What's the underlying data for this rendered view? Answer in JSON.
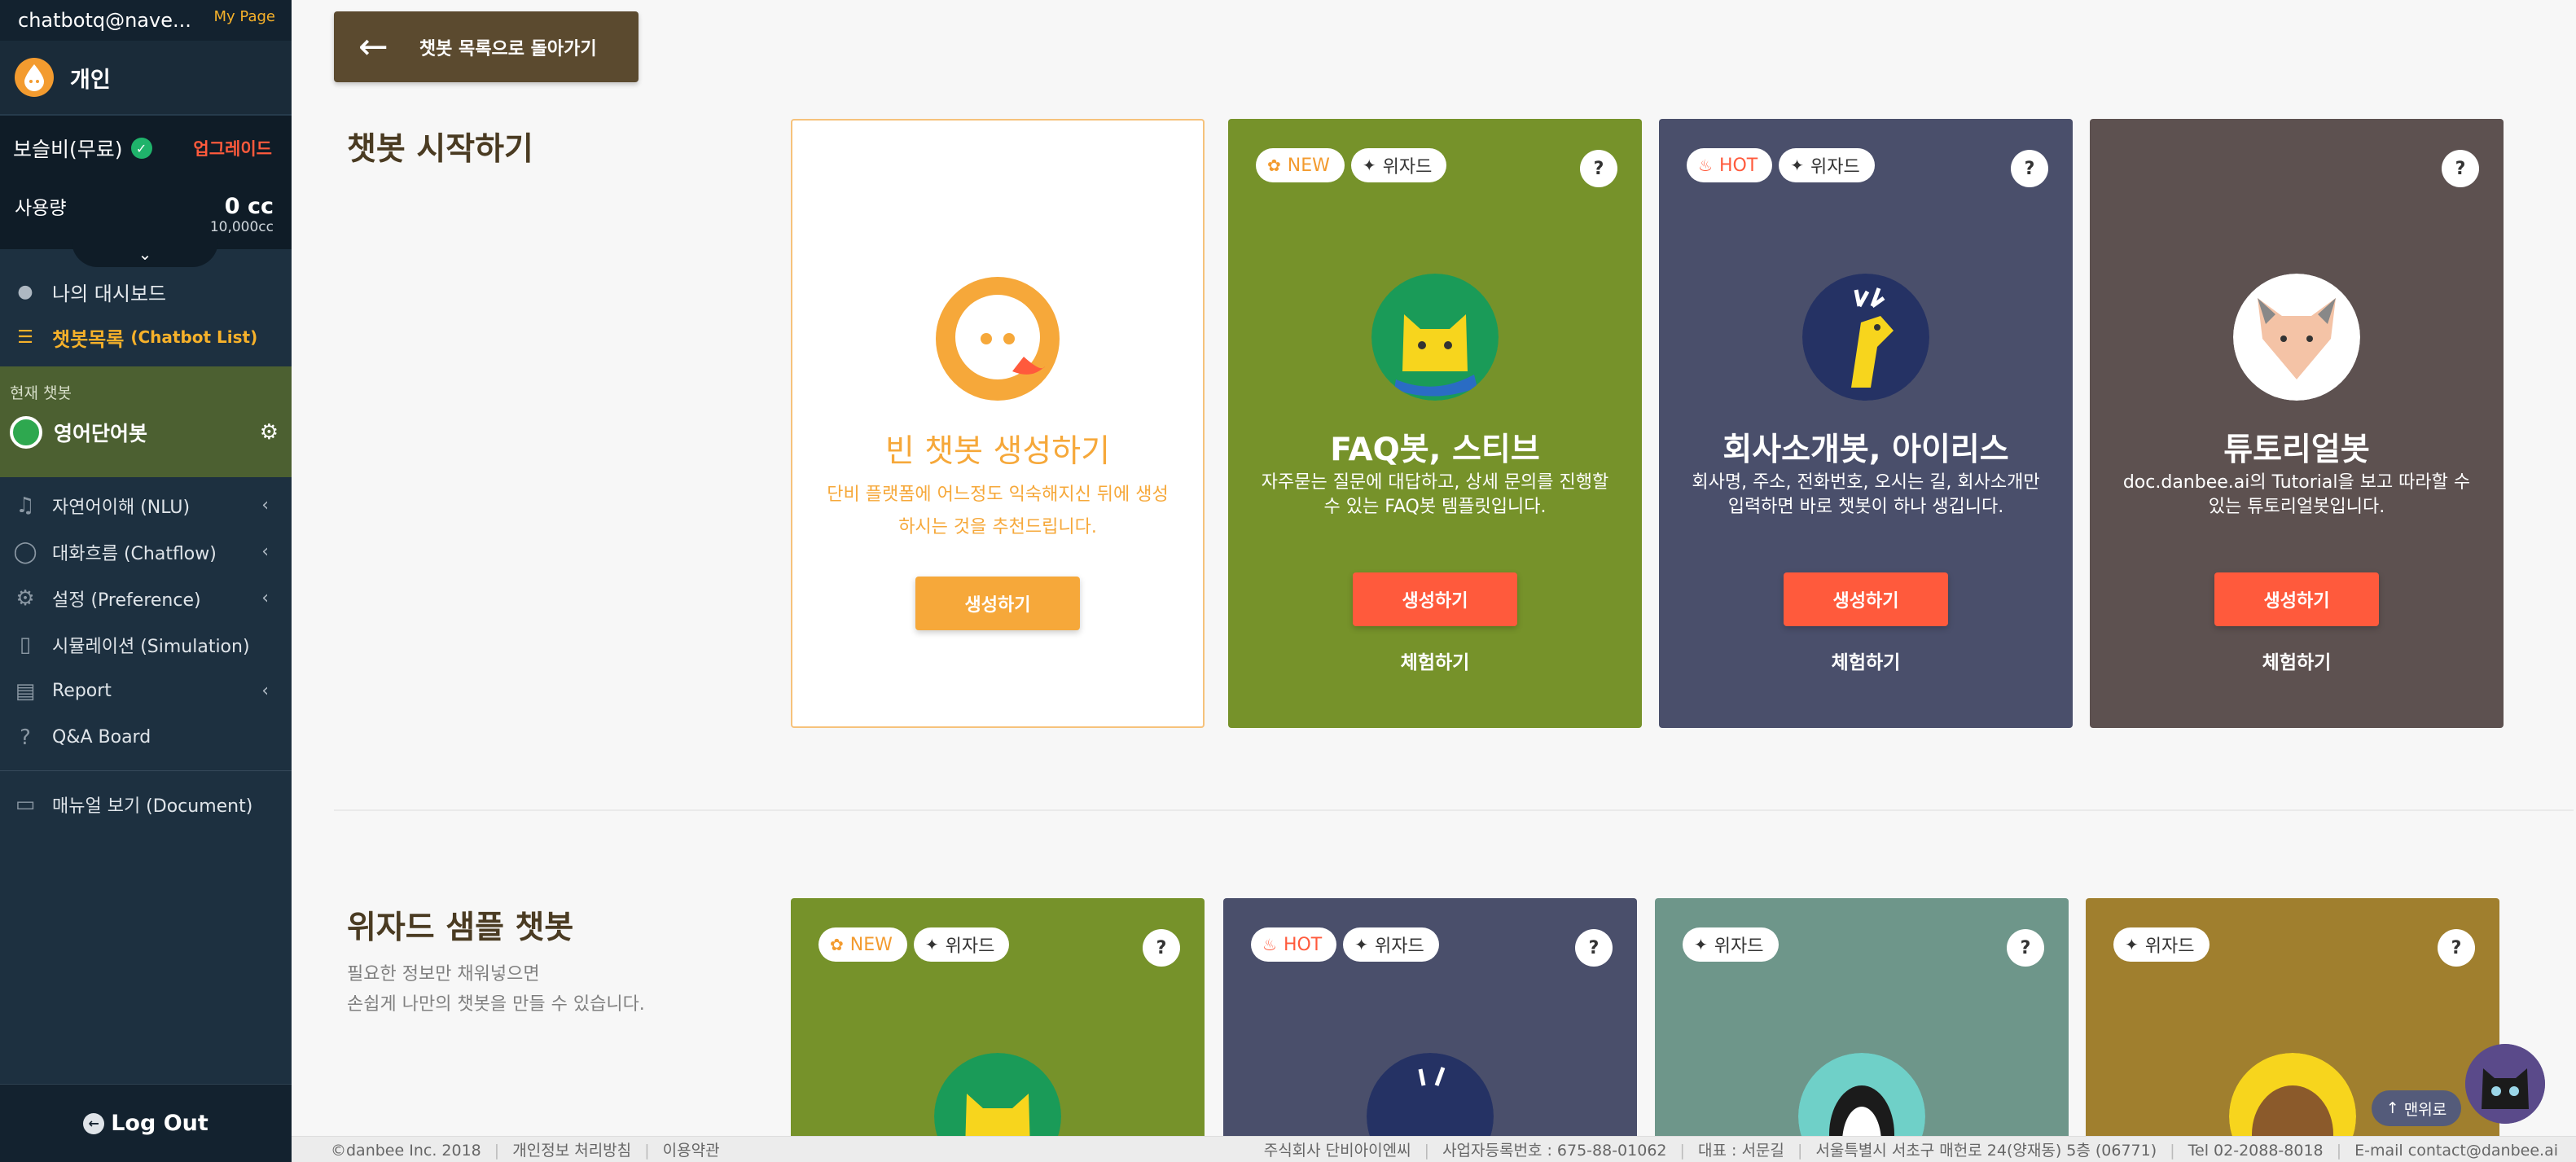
{
  "sidebar": {
    "email": "chatbotq@nave...",
    "mypage": "My Page",
    "account_name": "개인",
    "plan": "보슬비(무료)",
    "upgrade": "업그레이드",
    "usage_label": "사용량",
    "usage_value": "0 cc",
    "usage_limit": "10,000cc",
    "dashboard": "나의 대시보드",
    "chatbot_list": "챗봇목록",
    "chatbot_list_sub": "(Chatbot List)",
    "current_label": "현재 챗봇",
    "current_name": "영어단어봇",
    "menu": [
      {
        "label": "자연어이해 (NLU)",
        "icon": "headphone-icon",
        "arrow": "‹"
      },
      {
        "label": "대화흐름 (Chatflow)",
        "icon": "chat-icon",
        "arrow": "‹"
      },
      {
        "label": "설정 (Preference)",
        "icon": "gears-icon",
        "arrow": "‹"
      },
      {
        "label": "시뮬레이션 (Simulation)",
        "icon": "phone-icon",
        "arrow": ""
      },
      {
        "label": "Report",
        "icon": "chart-icon",
        "arrow": "‹"
      },
      {
        "label": "Q&A Board",
        "icon": "question-icon",
        "arrow": ""
      }
    ],
    "manual": "매뉴얼 보기 (Document)",
    "logout": "Log Out"
  },
  "main": {
    "back_label": "챗봇 목록으로 돌아가기",
    "section1_title": "챗봇 시작하기",
    "section2_title": "위자드 샘플 챗봇",
    "section2_desc_line1": "필요한 정보만 채워넣으면",
    "section2_desc_line2": "손쉽게 나만의 챗봇을 만들 수 있습니다.",
    "blank_card": {
      "title": "빈 챗봇 생성하기",
      "desc": "단비 플랫폼에 어느정도 익숙해지신 뒤에 생성하시는 것을 추천드립니다.",
      "button": "생성하기"
    },
    "cards": [
      {
        "title": "FAQ봇, 스티브",
        "desc": "자주묻는 질문에 대답하고, 상세 문의를 진행할 수 있는 FAQ봇 템플릿입니다.",
        "button": "생성하기",
        "try": "체험하기",
        "color": "#76922a",
        "badge": "NEW",
        "wizard": "위자드",
        "help": "?"
      },
      {
        "title": "회사소개봇, 아이리스",
        "desc": "회사명, 주소, 전화번호, 오시는 길, 회사소개만 입력하면 바로 챗봇이 하나 생깁니다.",
        "button": "생성하기",
        "try": "체험하기",
        "color": "#4a4f6b",
        "badge": "HOT",
        "wizard": "위자드",
        "help": "?"
      },
      {
        "title": "튜토리얼봇",
        "desc": "doc.danbee.ai의 Tutorial을 보고 따라할 수 있는 튜토리얼봇입니다.",
        "button": "생성하기",
        "try": "체험하기",
        "color": "#5d5150",
        "help": "?"
      }
    ],
    "wizard_cards": [
      {
        "badge": "NEW",
        "wizard": "위자드",
        "help": "?",
        "color": "#76922a"
      },
      {
        "badge": "HOT",
        "wizard": "위자드",
        "help": "?",
        "color": "#4a4f6b"
      },
      {
        "wizard": "위자드",
        "help": "?",
        "color": "#6e968a"
      },
      {
        "wizard": "위자드",
        "help": "?",
        "color": "#a07f2e"
      }
    ]
  },
  "footer": {
    "copyright": "©danbee Inc. 2018",
    "privacy": "개인정보 처리방침",
    "terms": "이용약관",
    "company": "주식회사 단비아이엔씨",
    "biz_no": "사업자등록번호 : 675-88-01062",
    "ceo": "대표 : 서문길",
    "address": "서울특별시 서초구 매헌로 24(양재동) 5층 (06771)",
    "tel": "Tel 02-2088-8018",
    "email": "E-mail contact@danbee.ai"
  },
  "float": {
    "top_button": "맨위로"
  }
}
